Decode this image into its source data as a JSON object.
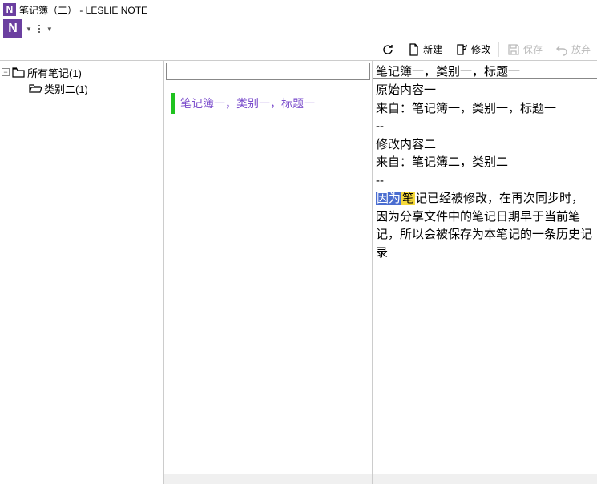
{
  "window": {
    "title": "笔记簿（二） - LESLIE NOTE"
  },
  "toolbar": {
    "refresh": "",
    "new_label": "新建",
    "edit_label": "修改",
    "save_label": "保存",
    "discard_label": "放弃"
  },
  "tree": {
    "root": {
      "label": "所有笔记(1)"
    },
    "child": {
      "label": "类别二(1)"
    }
  },
  "list": {
    "items": [
      {
        "title": "笔记簿一，类别一，标题一"
      }
    ]
  },
  "content": {
    "title": "笔记簿一，类别一，标题一",
    "line1": "原始内容一",
    "line2": "来自：笔记簿一，类别一，标题一",
    "divider1": "--",
    "line3": "修改内容二",
    "line4": "来自：笔记簿二，类别二",
    "divider2": "--",
    "highlight_blue": "因为",
    "highlight_yellow": "笔",
    "paragraph_rest": "记已经被修改，在再次同步时，因为分享文件中的笔记日期早于当前笔记，所以会被保存为本笔记的一条历史记录"
  }
}
